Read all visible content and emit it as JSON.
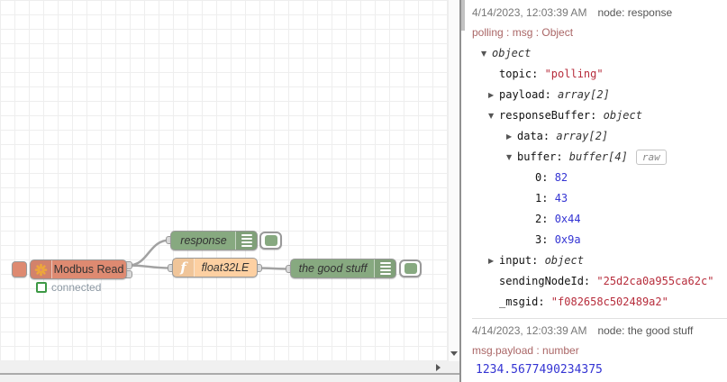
{
  "colors": {
    "modbus_node": "#de8a71",
    "debug_node": "#87a980",
    "function_node": "#fdd0a2",
    "node_border": "#999999",
    "wire": "#a2a2a2",
    "grid_line": "#eeeeee",
    "status_green": "#3d9945",
    "status_text": "#8c98a3",
    "timestamp_text": "#777777",
    "node_name_text": "#555555",
    "meta_text": "#aa6666",
    "key_text": "#111111",
    "type_text": "#333333",
    "string_value": "#b72d3c",
    "number_value": "#3434d3",
    "modbus_icon": "#eda63b"
  },
  "icons": {
    "modbus": "gear-flower",
    "function": "f",
    "debug_list": "menu-bars",
    "collapse": "▼",
    "expand": "▶"
  },
  "flow": {
    "modbus": {
      "label": "Modbus Read",
      "status": "connected"
    },
    "response_node": {
      "label": "response"
    },
    "function_node": {
      "label": "float32LE"
    },
    "debug_node": {
      "label": "the good stuff"
    }
  },
  "debug": {
    "raw_label": "raw",
    "messages": [
      {
        "timestamp": "4/14/2023, 12:03:39 AM",
        "node": "node: response",
        "meta": "polling : msg : Object",
        "tree": [
          {
            "depth": 0,
            "arrow": "down",
            "key": "",
            "value": "object",
            "vtype": "type"
          },
          {
            "depth": 1,
            "arrow": "none",
            "key": "topic",
            "value": "\"polling\"",
            "vtype": "string"
          },
          {
            "depth": 1,
            "arrow": "right",
            "key": "payload",
            "value": "array[2]",
            "vtype": "type"
          },
          {
            "depth": 1,
            "arrow": "down",
            "key": "responseBuffer",
            "value": "object",
            "vtype": "type"
          },
          {
            "depth": 2,
            "arrow": "right",
            "key": "data",
            "value": "array[2]",
            "vtype": "type"
          },
          {
            "depth": 2,
            "arrow": "down",
            "key": "buffer",
            "value": "buffer[4]",
            "vtype": "type",
            "raw": true
          },
          {
            "depth": 3,
            "arrow": "none",
            "key": "0",
            "value": "82",
            "vtype": "number"
          },
          {
            "depth": 3,
            "arrow": "none",
            "key": "1",
            "value": "43",
            "vtype": "number"
          },
          {
            "depth": 3,
            "arrow": "none",
            "key": "2",
            "value": "0x44",
            "vtype": "number"
          },
          {
            "depth": 3,
            "arrow": "none",
            "key": "3",
            "value": "0x9a",
            "vtype": "number"
          },
          {
            "depth": 1,
            "arrow": "right",
            "key": "input",
            "value": "object",
            "vtype": "type"
          },
          {
            "depth": 1,
            "arrow": "none",
            "key": "sendingNodeId",
            "value": "\"25d2ca0a955ca62c\"",
            "vtype": "string"
          },
          {
            "depth": 1,
            "arrow": "none",
            "key": "_msgid",
            "value": "\"f082658c502489a2\"",
            "vtype": "string"
          }
        ]
      },
      {
        "timestamp": "4/14/2023, 12:03:39 AM",
        "node": "node: the good stuff",
        "meta": "msg.payload : number",
        "value": "1234.5677490234375"
      }
    ]
  }
}
